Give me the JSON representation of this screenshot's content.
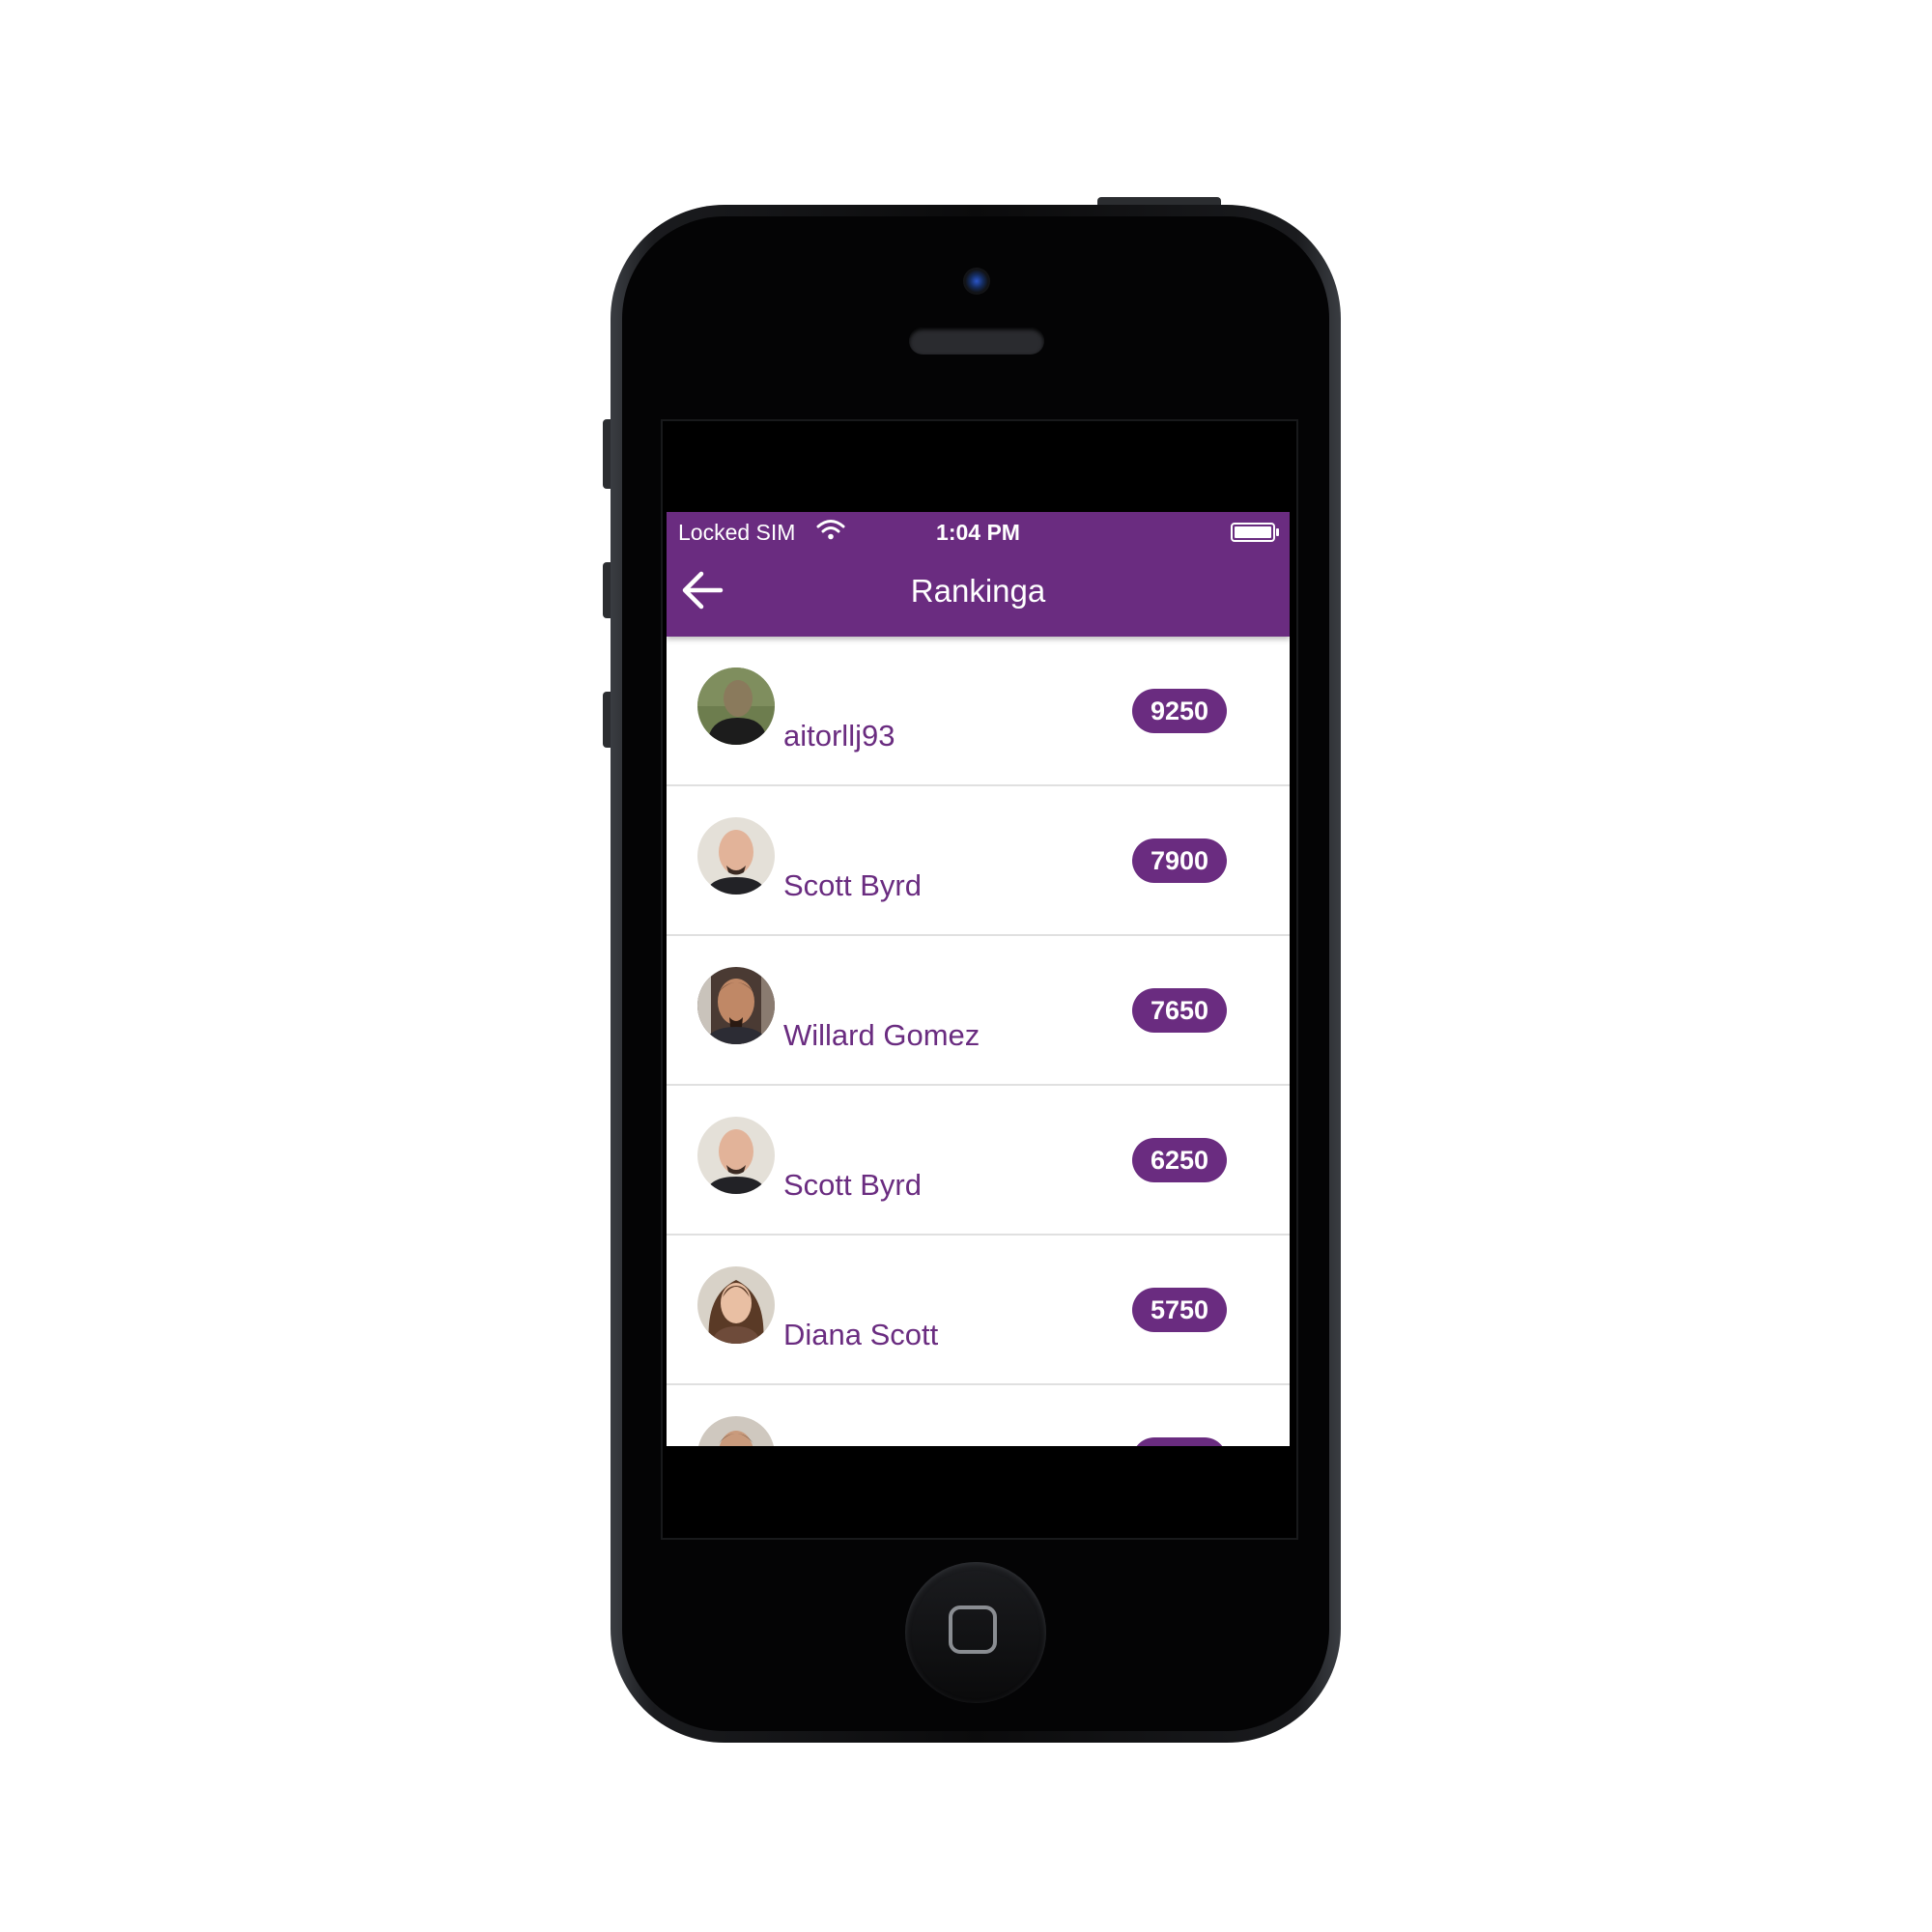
{
  "status_bar": {
    "carrier": "Locked SIM",
    "time": "1:04 PM",
    "wifi_icon": "wifi-icon",
    "battery_icon": "battery-full-icon"
  },
  "header": {
    "title": "Rankinga",
    "back_icon": "arrow-left-icon"
  },
  "theme": {
    "primary": "#6a2c80",
    "on_primary": "#ffffff",
    "divider": "#e0e0e0"
  },
  "rankings": [
    {
      "name": "aitorllj93",
      "score": "9250"
    },
    {
      "name": "Scott Byrd",
      "score": "7900"
    },
    {
      "name": "Willard Gomez",
      "score": "7650"
    },
    {
      "name": "Scott Byrd",
      "score": "6250"
    },
    {
      "name": "Diana Scott",
      "score": "5750"
    },
    {
      "name": "",
      "score": ""
    }
  ]
}
